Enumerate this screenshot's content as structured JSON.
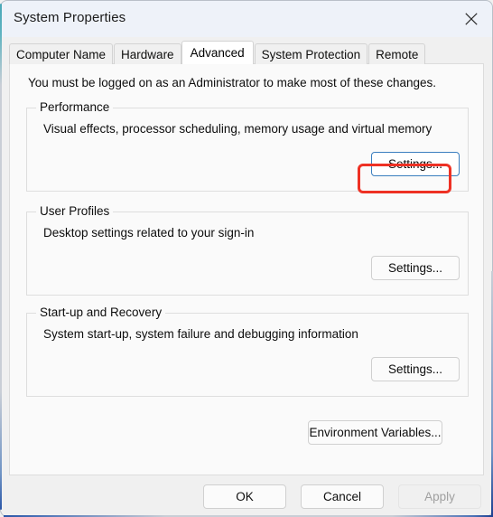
{
  "window": {
    "title": "System Properties",
    "close_icon": "close-icon"
  },
  "tabs": [
    {
      "label": "Computer Name",
      "selected": false
    },
    {
      "label": "Hardware",
      "selected": false
    },
    {
      "label": "Advanced",
      "selected": true
    },
    {
      "label": "System Protection",
      "selected": false
    },
    {
      "label": "Remote",
      "selected": false
    }
  ],
  "content": {
    "admin_note": "You must be logged on as an Administrator to make most of these changes.",
    "groups": [
      {
        "label": "Performance",
        "description": "Visual effects, processor scheduling, memory usage and virtual memory",
        "button_label": "Settings...",
        "button_focused": true,
        "highlighted": true
      },
      {
        "label": "User Profiles",
        "description": "Desktop settings related to your sign-in",
        "button_label": "Settings...",
        "button_focused": false,
        "highlighted": false
      },
      {
        "label": "Start-up and Recovery",
        "description": "System start-up, system failure and debugging information",
        "button_label": "Settings...",
        "button_focused": false,
        "highlighted": false
      }
    ],
    "environment_variables_label": "Environment Variables..."
  },
  "footer": {
    "ok_label": "OK",
    "cancel_label": "Cancel",
    "apply_label": "Apply",
    "apply_disabled": true
  },
  "colors": {
    "highlight_red": "#ee3124",
    "focus_blue": "#3a7ebf",
    "titlebar_bg": "#eef2f9",
    "panel_bg": "#fafafa",
    "dialog_bg": "#f0f0f0"
  }
}
